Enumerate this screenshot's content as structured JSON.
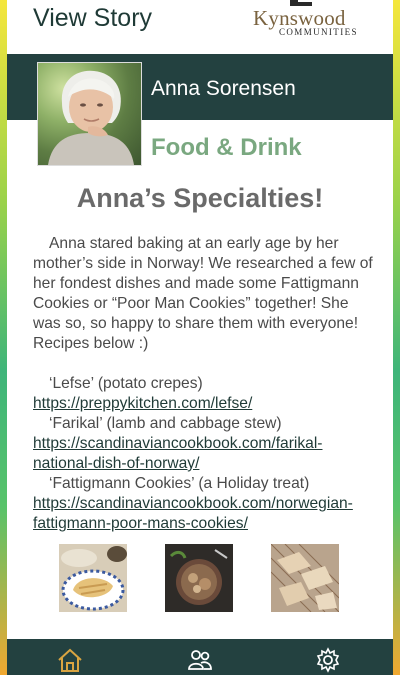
{
  "header": {
    "title": "View Story"
  },
  "logo": {
    "word": "Kynswood",
    "sub": "COMMUNITIES"
  },
  "profile": {
    "name": "Anna Sorensen",
    "category": "Food & Drink"
  },
  "story": {
    "headline": "Anna’s Specialties!",
    "paragraph": "Anna stared baking at an early age by her mother’s side in Norway! We researched a few of her fondest dishes and made some Fattigmann Cookies or “Poor Man Cookies” together! She was so, so happy to share them with everyone! Recipes below :)",
    "recipes": [
      {
        "name": "‘Lefse’ (potato crepes)",
        "link": "https://preppykitchen.com/lefse/"
      },
      {
        "name": "‘Farikal’ (lamb and cabbage stew)",
        "link": "https://scandinaviancookbook.com/farikal-national-dish-of-norway/"
      },
      {
        "name": "‘Fattigmann Cookies’ (a Holiday treat)",
        "link": "https://scandinaviancookbook.com/norwegian-fattigmann-poor-mans-cookies/"
      }
    ]
  },
  "nav": {
    "items": [
      "home-icon",
      "people-icon",
      "settings-icon"
    ],
    "active_color": "#d9a441",
    "icon_color": "#ffffff"
  },
  "colors": {
    "banner": "#234140",
    "category": "#7aa880",
    "headline": "#6a6a6a"
  }
}
